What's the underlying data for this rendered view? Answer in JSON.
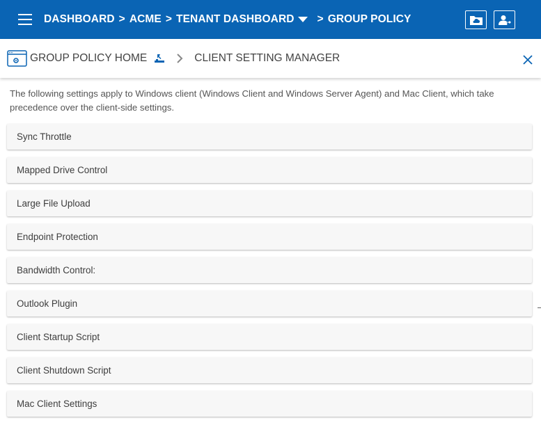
{
  "header": {
    "breadcrumb": {
      "dashboard": "DASHBOARD",
      "acme": "ACME",
      "tenant": "TENANT DASHBOARD",
      "group_policy": "GROUP POLICY",
      "separator": ">"
    },
    "icons": [
      "menu-icon",
      "cloud-folder-icon",
      "user-switch-icon",
      "chevron-down-icon"
    ],
    "background_color": "#0a64b4"
  },
  "subheader": {
    "home_label": "GROUP POLICY HOME",
    "current_label": "CLIENT SETTING MANAGER",
    "icons": [
      "settings-window-icon",
      "hierarchy-icon",
      "chevron-right-icon",
      "close-icon"
    ],
    "accent_color": "#0a64b4"
  },
  "description": "The following settings apply to Windows client (Windows Client and Windows Server Agent) and Mac Client, which take precedence over the client-side settings.",
  "settings": [
    {
      "label": "Sync Throttle"
    },
    {
      "label": "Mapped Drive Control"
    },
    {
      "label": "Large File Upload"
    },
    {
      "label": "Endpoint Protection"
    },
    {
      "label": "Bandwidth Control:"
    },
    {
      "label": "Outlook Plugin"
    },
    {
      "label": "Client Startup Script"
    },
    {
      "label": "Client Shutdown Script"
    },
    {
      "label": "Mac Client Settings"
    }
  ]
}
